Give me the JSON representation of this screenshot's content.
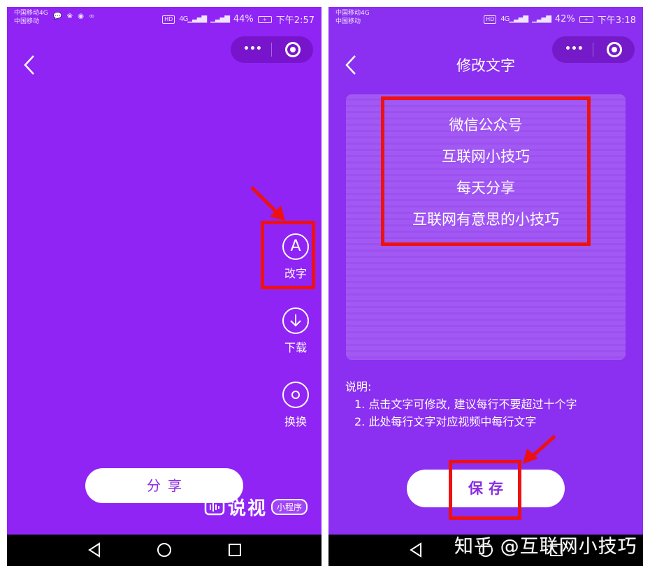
{
  "colors": {
    "purple_bg_left": "#9024f5",
    "purple_bg_right": "#8b2ff0",
    "button_text": "#8a2be2",
    "highlight_red": "#ee1111",
    "nav_bar": "#000000"
  },
  "left": {
    "status": {
      "carrier_line1": "中国移动4G",
      "carrier_line2": "中国移动",
      "hd": "HD",
      "battery": "44%",
      "time": "下午2:57"
    },
    "tools": [
      {
        "label": "改字",
        "icon": "font-a-icon"
      },
      {
        "label": "下载",
        "icon": "download-icon"
      },
      {
        "label": "换换",
        "icon": "swap-ring-icon"
      }
    ],
    "share_label": "分享",
    "brand_name": "说视",
    "mini_program_badge": "小程序"
  },
  "right": {
    "status": {
      "carrier_line1": "中国移动4G",
      "carrier_line2": "中国移动",
      "hd": "HD",
      "battery": "42%",
      "time": "下午3:18"
    },
    "title": "修改文字",
    "text_lines": [
      "微信公众号",
      "互联网小技巧",
      "每天分享",
      "互联网有意思的小技巧"
    ],
    "notes_heading": "说明:",
    "notes": [
      "1. 点击文字可修改, 建议每行不要超过十个字",
      "2. 此处每行文字对应视频中每行文字"
    ],
    "save_label": "保存"
  },
  "watermark": "知乎 @互联网小技巧"
}
